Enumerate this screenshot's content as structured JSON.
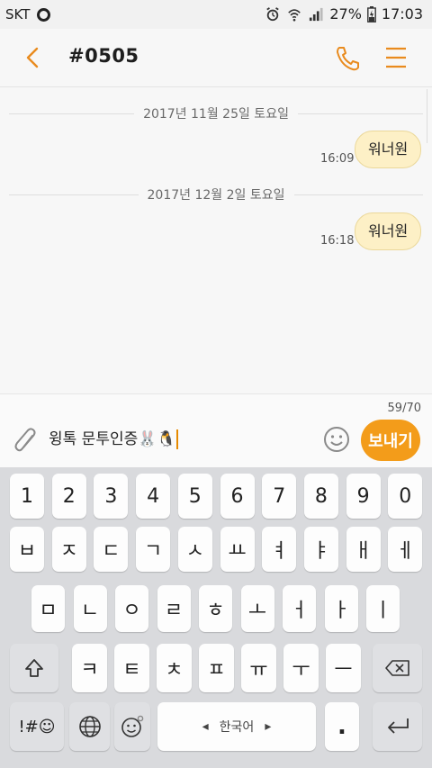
{
  "status_bar": {
    "carrier": "SKT",
    "battery": "27%",
    "time": "17:03"
  },
  "header": {
    "title": "#0505"
  },
  "conversation": {
    "groups": [
      {
        "date": "2017년 11월 25일 토요일",
        "time": "16:09",
        "text": "워너원"
      },
      {
        "date": "2017년 12월 2일 토요일",
        "time": "16:18",
        "text": "워너원"
      }
    ]
  },
  "compose": {
    "counter": "59/70",
    "text": "윙톡 문투인증🐰🐧",
    "send_label": "보내기"
  },
  "keyboard": {
    "row1": [
      "1",
      "2",
      "3",
      "4",
      "5",
      "6",
      "7",
      "8",
      "9",
      "0"
    ],
    "row2": [
      "ㅂ",
      "ㅈ",
      "ㄷ",
      "ㄱ",
      "ㅅ",
      "ㅛ",
      "ㅕ",
      "ㅑ",
      "ㅐ",
      "ㅔ"
    ],
    "row3": [
      "ㅁ",
      "ㄴ",
      "ㅇ",
      "ㄹ",
      "ㅎ",
      "ㅗ",
      "ㅓ",
      "ㅏ",
      "ㅣ"
    ],
    "row4": [
      "ㅋ",
      "ㅌ",
      "ㅊ",
      "ㅍ",
      "ㅠ",
      "ㅜ",
      "ㅡ"
    ],
    "symbols_label": "!#☺",
    "space_label": "한국어",
    "period_label": "."
  },
  "colors": {
    "accent": "#e98b1e",
    "send_button": "#f39c1a",
    "bubble": "#fdf0c6"
  }
}
